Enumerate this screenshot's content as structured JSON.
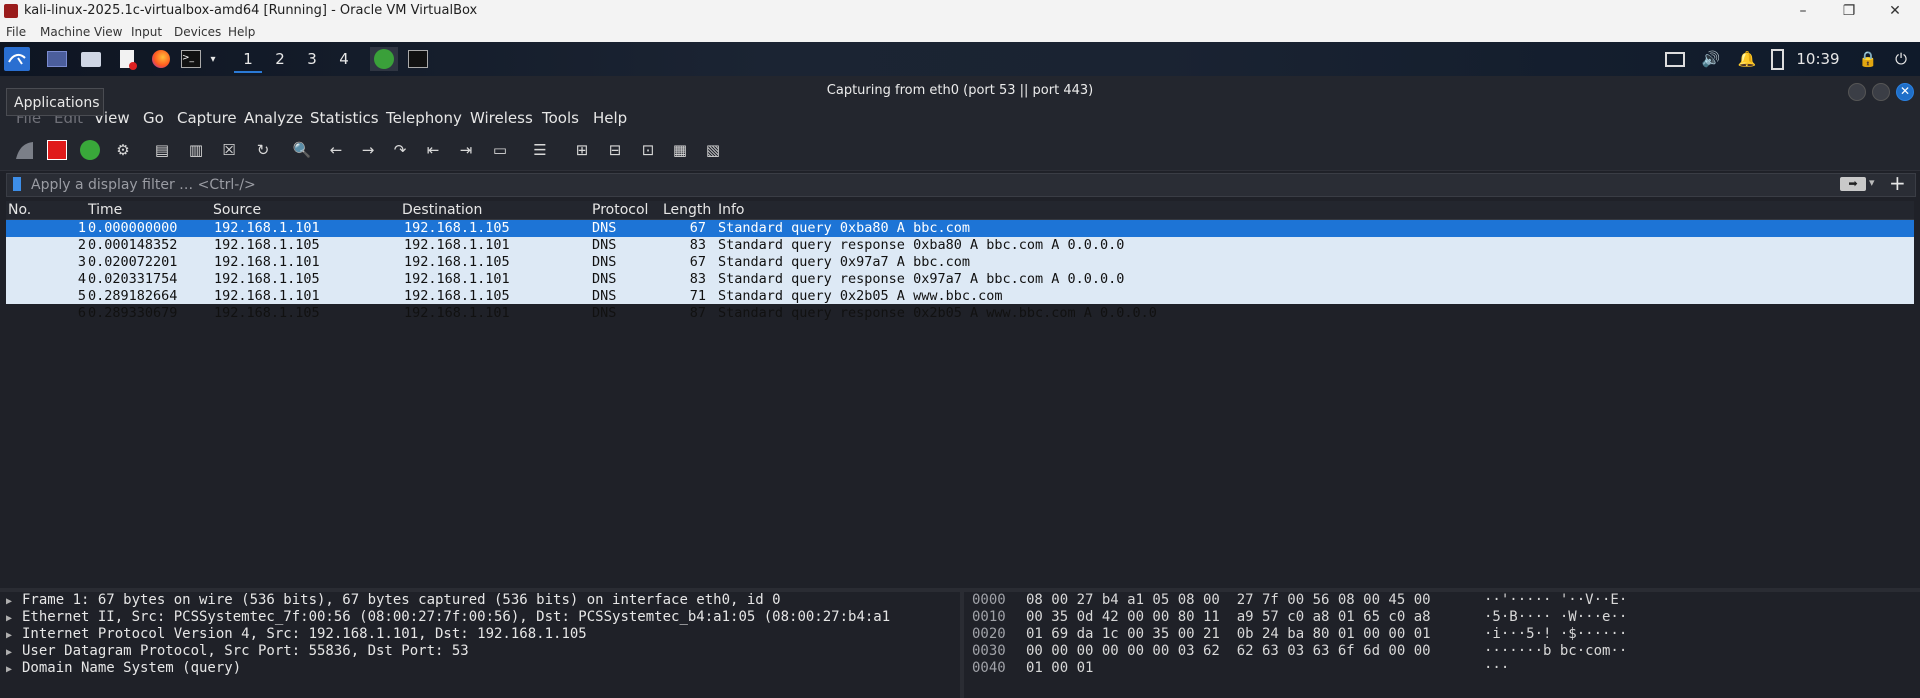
{
  "vbox": {
    "title": "kali-linux-2025.1c-virtualbox-amd64 [Running] - Oracle VM VirtualBox",
    "menu": [
      "File",
      "Machine",
      "View",
      "Input",
      "Devices",
      "Help"
    ],
    "controls": {
      "minimize": "–",
      "restore": "❐",
      "close": "✕"
    }
  },
  "panel": {
    "workspaces": [
      "1",
      "2",
      "3",
      "4"
    ],
    "clock": "10:39"
  },
  "wireshark": {
    "title": "Capturing from eth0 (port 53 || port 443)",
    "tooltip": "Applications",
    "menu": [
      "File",
      "Edit",
      "View",
      "Go",
      "Capture",
      "Analyze",
      "Statistics",
      "Telephony",
      "Wireless",
      "Tools",
      "Help"
    ],
    "filter_placeholder": "Apply a display filter … <Ctrl-/>",
    "columns": [
      "No.",
      "Time",
      "Source",
      "Destination",
      "Protocol",
      "Length",
      "Info"
    ],
    "packets": [
      {
        "no": "1",
        "time": "0.000000000",
        "src": "192.168.1.101",
        "dst": "192.168.1.105",
        "proto": "DNS",
        "len": "67",
        "info": "Standard query 0xba80 A bbc.com"
      },
      {
        "no": "2",
        "time": "0.000148352",
        "src": "192.168.1.105",
        "dst": "192.168.1.101",
        "proto": "DNS",
        "len": "83",
        "info": "Standard query response 0xba80 A bbc.com A 0.0.0.0"
      },
      {
        "no": "3",
        "time": "0.020072201",
        "src": "192.168.1.101",
        "dst": "192.168.1.105",
        "proto": "DNS",
        "len": "67",
        "info": "Standard query 0x97a7 A bbc.com"
      },
      {
        "no": "4",
        "time": "0.020331754",
        "src": "192.168.1.105",
        "dst": "192.168.1.101",
        "proto": "DNS",
        "len": "83",
        "info": "Standard query response 0x97a7 A bbc.com A 0.0.0.0"
      },
      {
        "no": "5",
        "time": "0.289182664",
        "src": "192.168.1.101",
        "dst": "192.168.1.105",
        "proto": "DNS",
        "len": "71",
        "info": "Standard query 0x2b05 A www.bbc.com"
      },
      {
        "no": "6",
        "time": "0.289330679",
        "src": "192.168.1.105",
        "dst": "192.168.1.101",
        "proto": "DNS",
        "len": "87",
        "info": "Standard query response 0x2b05 A www.bbc.com A 0.0.0.0"
      }
    ],
    "details": [
      "Frame 1: 67 bytes on wire (536 bits), 67 bytes captured (536 bits) on interface eth0, id 0",
      "Ethernet II, Src: PCSSystemtec_7f:00:56 (08:00:27:7f:00:56), Dst: PCSSystemtec_b4:a1:05 (08:00:27:b4:a1",
      "Internet Protocol Version 4, Src: 192.168.1.101, Dst: 192.168.1.105",
      "User Datagram Protocol, Src Port: 55836, Dst Port: 53",
      "Domain Name System (query)"
    ],
    "bytes": [
      {
        "off": "0000",
        "hex": "08 00 27 b4 a1 05 08 00  27 7f 00 56 08 00 45 00",
        "ascii": "··'····· '··V··E·"
      },
      {
        "off": "0010",
        "hex": "00 35 0d 42 00 00 80 11  a9 57 c0 a8 01 65 c0 a8",
        "ascii": "·5·B···· ·W···e··"
      },
      {
        "off": "0020",
        "hex": "01 69 da 1c 00 35 00 21  0b 24 ba 80 01 00 00 01",
        "ascii": "·i···5·! ·$······"
      },
      {
        "off": "0030",
        "hex": "00 00 00 00 00 00 03 62  62 63 03 63 6f 6d 00 00",
        "ascii": "·······b bc·com··"
      },
      {
        "off": "0040",
        "hex": "01 00 01",
        "ascii": "···"
      }
    ]
  }
}
